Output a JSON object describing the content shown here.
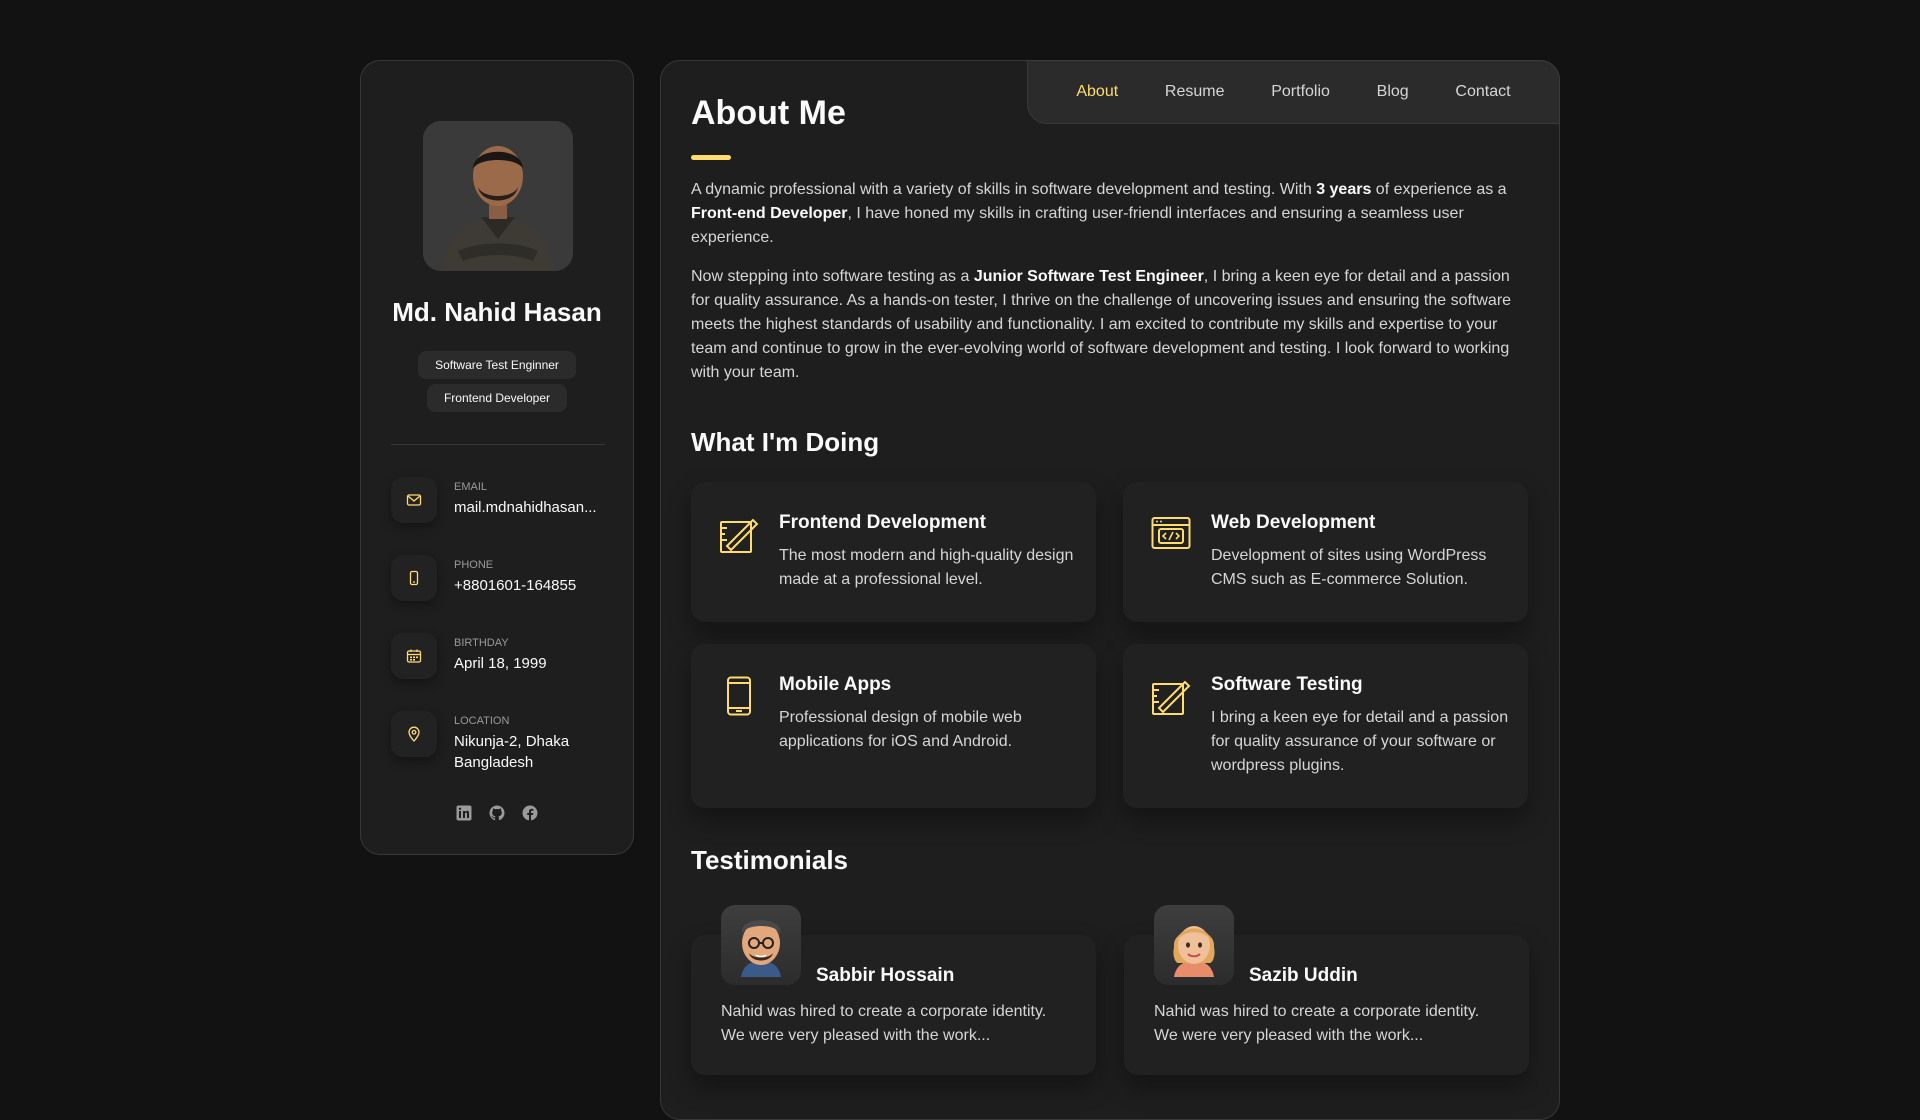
{
  "profile": {
    "name": "Md. Nahid Hasan",
    "titles": [
      "Software Test Enginner",
      "Frontend Developer"
    ],
    "contacts": [
      {
        "label": "EMAIL",
        "value": "mail.mdnahidhasan...",
        "icon": "mail-icon"
      },
      {
        "label": "PHONE",
        "value": "+8801601-164855",
        "icon": "phone-icon"
      },
      {
        "label": "BIRTHDAY",
        "value": "April 18, 1999",
        "icon": "calendar-icon"
      },
      {
        "label": "LOCATION",
        "value": "Nikunja-2, Dhaka Bangladesh",
        "icon": "location-pin-icon"
      }
    ],
    "socials": [
      "linkedin-icon",
      "github-icon",
      "facebook-icon"
    ]
  },
  "nav": {
    "items": [
      "About",
      "Resume",
      "Portfolio",
      "Blog",
      "Contact"
    ],
    "active": "About"
  },
  "about": {
    "title": "About Me",
    "p1": {
      "a": "A dynamic professional with a variety of skills in software development and testing. With ",
      "b": "3 years",
      "c": " of experience as a ",
      "d": "Front-end Developer",
      "e": ", I have honed my skills in crafting user-friendl interfaces and ensuring a seamless user experience."
    },
    "p2": {
      "a": "Now stepping into software testing as a ",
      "b": "Junior Software Test Engineer",
      "c": ", I bring a keen eye for detail and a passion for quality assurance. As a hands-on tester, I thrive on the challenge of uncovering issues and ensuring the software meets the highest standards of usability and functionality. I am excited to contribute my skills and expertise to your team and continue to grow in the ever-evolving world of software development and testing. I look forward to working with your team."
    }
  },
  "services": {
    "title": "What I'm Doing",
    "items": [
      {
        "title": "Frontend Development",
        "text": "The most modern and high-quality design made at a professional level.",
        "icon": "design-pencil-icon"
      },
      {
        "title": "Web Development",
        "text": "Development of sites using WordPress CMS such as E-commerce Solution.",
        "icon": "code-window-icon"
      },
      {
        "title": "Mobile Apps",
        "text": "Professional design of mobile web applications for iOS and Android.",
        "icon": "mobile-phone-icon"
      },
      {
        "title": "Software Testing",
        "text": "I bring a keen eye for detail and a passion for quality assurance of your software or wordpress plugins.",
        "icon": "design-pencil-icon"
      }
    ]
  },
  "testimonials": {
    "title": "Testimonials",
    "items": [
      {
        "name": "Sabbir Hossain",
        "text": "Nahid was hired to create a corporate identity. We were very pleased with the work..."
      },
      {
        "name": "Sazib Uddin",
        "text": "Nahid was hired to create a corporate identity. We were very pleased with the work..."
      }
    ]
  },
  "colors": {
    "accent": "#ffdb70",
    "background": "#121212",
    "card": "#1e1e1f"
  }
}
